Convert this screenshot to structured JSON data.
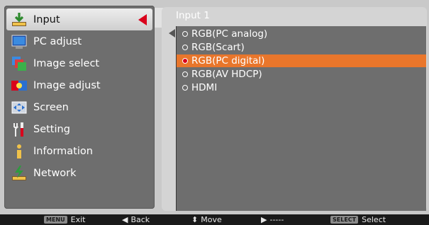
{
  "menu": {
    "items": [
      {
        "label": "Input",
        "icon": "input-icon",
        "selected": true
      },
      {
        "label": "PC adjust",
        "icon": "pc-adjust-icon",
        "selected": false
      },
      {
        "label": "Image select",
        "icon": "image-select-icon",
        "selected": false
      },
      {
        "label": "Image adjust",
        "icon": "image-adjust-icon",
        "selected": false
      },
      {
        "label": "Screen",
        "icon": "screen-icon",
        "selected": false
      },
      {
        "label": "Setting",
        "icon": "setting-icon",
        "selected": false
      },
      {
        "label": "Information",
        "icon": "information-icon",
        "selected": false
      },
      {
        "label": "Network",
        "icon": "network-icon",
        "selected": false
      }
    ]
  },
  "submenu": {
    "title": "Input 1",
    "options": [
      {
        "label": "RGB(PC analog)",
        "active": false
      },
      {
        "label": "RGB(Scart)",
        "active": false
      },
      {
        "label": "RGB(PC digital)",
        "active": true
      },
      {
        "label": "RGB(AV HDCP)",
        "active": false
      },
      {
        "label": "HDMI",
        "active": false
      }
    ]
  },
  "helpbar": {
    "menu_key": "MENU",
    "exit_label": "Exit",
    "back_glyph": "◀",
    "back_label": "Back",
    "move_glyph": "⬍",
    "move_label": "Move",
    "next_glyph": "▶",
    "next_label": "-----",
    "select_key": "SELECT",
    "select_label": "Select"
  },
  "colors": {
    "highlight": "#e9762b",
    "selected_arrow": "#d9001b",
    "panel": "#6e6e6e"
  }
}
